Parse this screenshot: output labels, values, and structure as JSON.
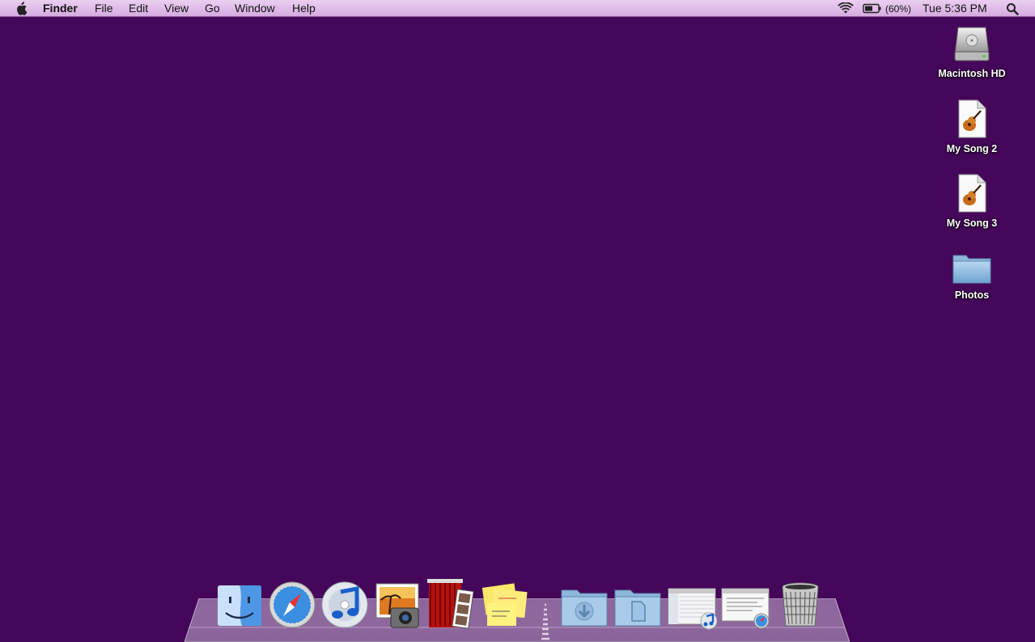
{
  "menubar": {
    "apple_icon": "apple-logo-icon",
    "app_name": "Finder",
    "items": [
      "File",
      "Edit",
      "View",
      "Go",
      "Window",
      "Help"
    ],
    "battery_percent": "(60%)",
    "clock": "Tue 5:36 PM",
    "status_icons": [
      "wifi-icon",
      "battery-icon",
      "spotlight-search-icon"
    ]
  },
  "desktop": {
    "background_color": "#45075a",
    "icons": [
      {
        "label": "Macintosh HD",
        "icon": "hard-drive-icon"
      },
      {
        "label": "My Song 2",
        "icon": "garageband-document-icon"
      },
      {
        "label": "My Song 3",
        "icon": "garageband-document-icon"
      },
      {
        "label": "Photos",
        "icon": "folder-icon"
      }
    ]
  },
  "dock": {
    "apps": [
      "finder-icon",
      "safari-icon",
      "itunes-icon",
      "iphoto-icon",
      "photo-booth-icon",
      "stickies-icon"
    ],
    "stacks": [
      "downloads-stack-icon",
      "documents-stack-icon",
      "itunes-window-icon",
      "safari-window-icon",
      "trash-icon"
    ]
  }
}
